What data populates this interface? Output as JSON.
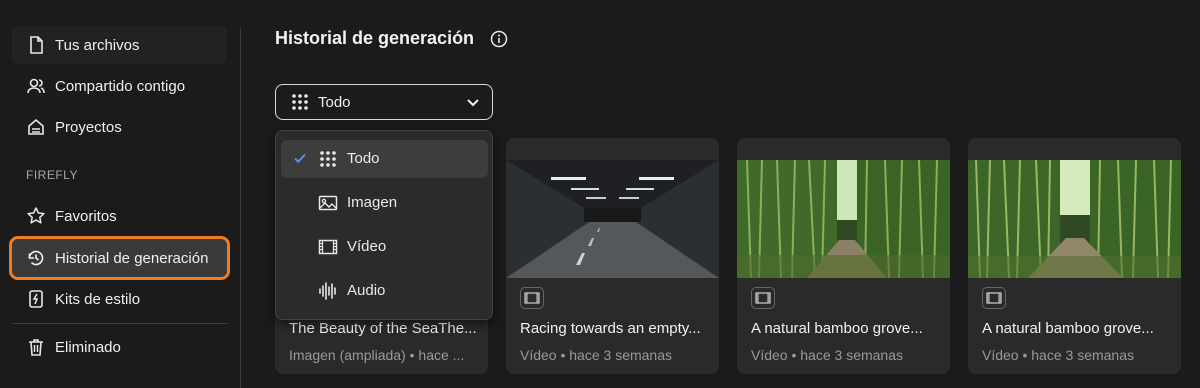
{
  "sidebar": {
    "items": [
      {
        "label": "Tus archivos",
        "icon": "file-icon"
      },
      {
        "label": "Compartido contigo",
        "icon": "users-icon"
      },
      {
        "label": "Proyectos",
        "icon": "projects-icon"
      }
    ],
    "section_label": "FIREFLY",
    "firefly_items": [
      {
        "label": "Favoritos",
        "icon": "star-icon"
      },
      {
        "label": "Historial de generación",
        "icon": "history-icon",
        "active": true
      },
      {
        "label": "Kits de estilo",
        "icon": "style-kit-icon"
      }
    ],
    "bottom_items": [
      {
        "label": "Eliminado",
        "icon": "trash-icon"
      }
    ]
  },
  "header": {
    "title": "Historial de generación",
    "info_icon": "info-icon"
  },
  "filter": {
    "selected_label": "Todo",
    "options": [
      {
        "label": "Todo",
        "icon": "grid-icon",
        "selected": true
      },
      {
        "label": "Imagen",
        "icon": "image-icon"
      },
      {
        "label": "Vídeo",
        "icon": "video-icon"
      },
      {
        "label": "Audio",
        "icon": "audio-icon"
      }
    ]
  },
  "cards": [
    {
      "title": "The Beauty of the SeaThe...",
      "meta": "Imagen (ampliada) • hace ..."
    },
    {
      "title": "Racing towards an empty...",
      "meta": "Vídeo • hace 3 semanas",
      "type_icon": "video-icon"
    },
    {
      "title": "A natural bamboo grove...",
      "meta": "Vídeo • hace 3 semanas",
      "type_icon": "video-icon"
    },
    {
      "title": "A natural bamboo grove...",
      "meta": "Vídeo • hace 3 semanas",
      "type_icon": "video-icon"
    }
  ],
  "colors": {
    "background": "#1b1b1b",
    "card": "#2a2a2a",
    "active_outline": "#f07d1f",
    "check": "#5b8def"
  }
}
